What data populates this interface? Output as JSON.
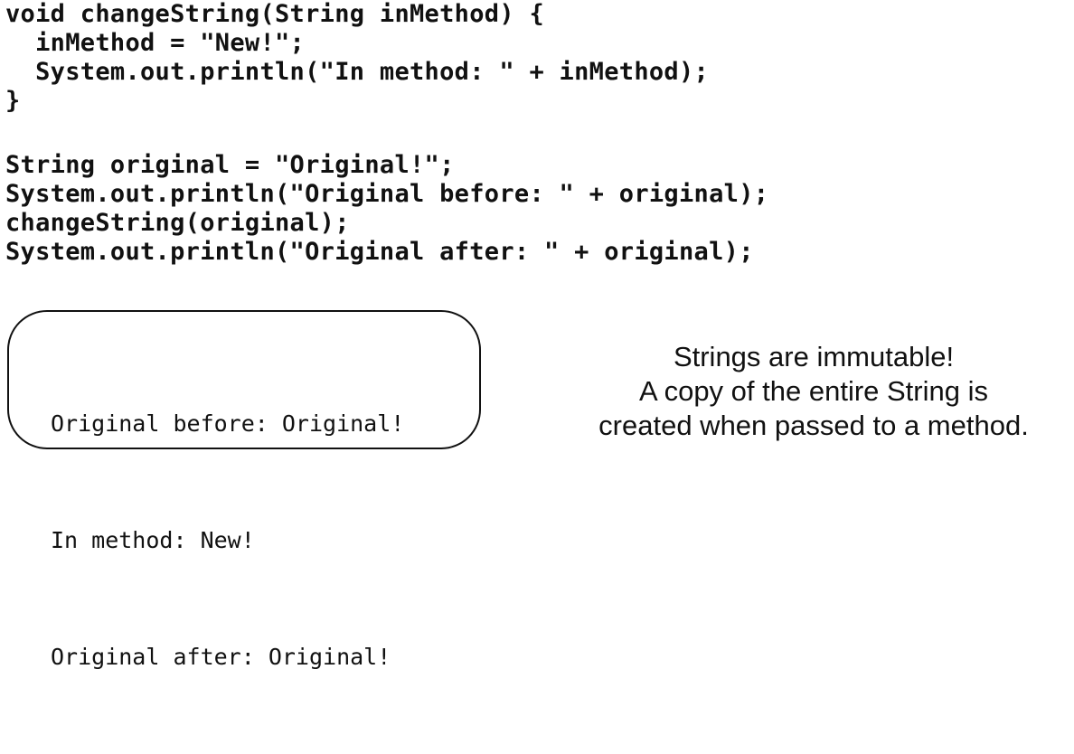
{
  "code_block_1": {
    "lines": [
      "void changeString(String inMethod) {",
      "  inMethod = \"New!\";",
      "  System.out.println(\"In method: \" + inMethod);",
      "}"
    ]
  },
  "code_block_2": {
    "lines": [
      "String original = \"Original!\";",
      "System.out.println(\"Original before: \" + original);",
      "changeString(original);",
      "System.out.println(\"Original after: \" + original);"
    ]
  },
  "output": {
    "lines": [
      "Original before: Original!",
      "In method: New!",
      "Original after: Original!"
    ]
  },
  "note": {
    "lines": [
      "Strings are immutable!",
      "A copy of the entire String is",
      "created when passed to a method."
    ]
  }
}
